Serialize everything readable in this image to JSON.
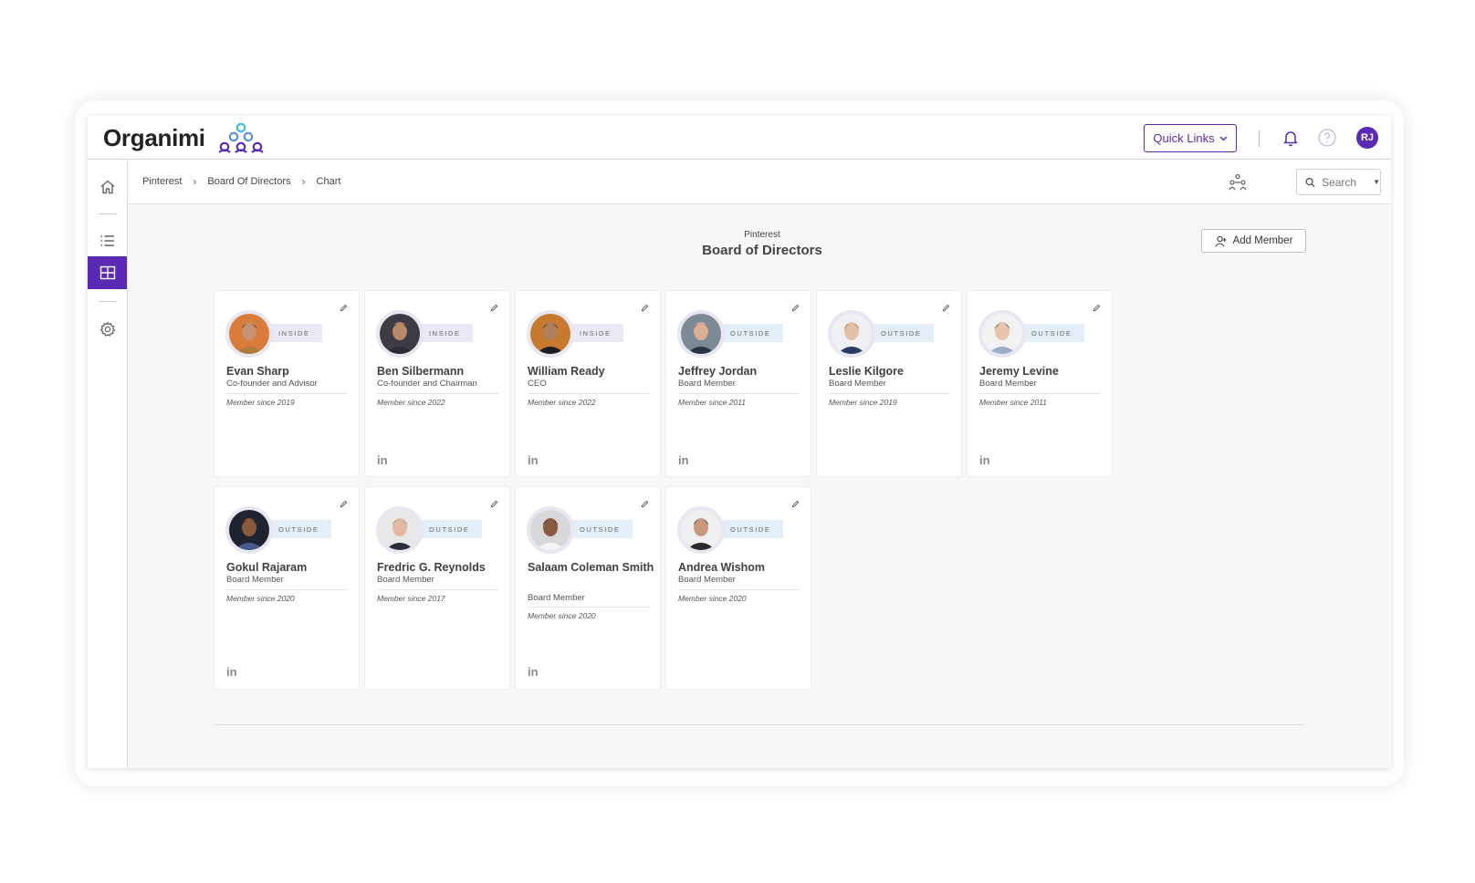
{
  "brand": {
    "name": "Organimi",
    "accent": "#5b2ab5"
  },
  "header": {
    "quick_links_label": "Quick Links",
    "user_initials": "RJ"
  },
  "sidebar": {
    "items": [
      "home-icon",
      "list-icon",
      "grid-icon",
      "settings-icon"
    ],
    "active": "grid-icon"
  },
  "breadcrumb": [
    "Pinterest",
    "Board Of Directors",
    "Chart"
  ],
  "search": {
    "placeholder": "Search"
  },
  "page": {
    "organization": "Pinterest",
    "title": "Board of Directors",
    "add_member_label": "Add Member"
  },
  "members": [
    {
      "name": "Evan Sharp",
      "role": "Co-founder and Advisor",
      "badge": "INSIDE",
      "since": "Member since 2019",
      "linkedin": false
    },
    {
      "name": "Ben Silbermann",
      "role": "Co-founder and Chairman",
      "badge": "INSIDE",
      "since": "Member since 2022",
      "linkedin": true
    },
    {
      "name": "William Ready",
      "role": "CEO",
      "badge": "INSIDE",
      "since": "Member since 2022",
      "linkedin": true
    },
    {
      "name": "Jeffrey Jordan",
      "role": "Board Member",
      "badge": "OUTSIDE",
      "since": "Member since 2011",
      "linkedin": true
    },
    {
      "name": "Leslie Kilgore",
      "role": "Board Member",
      "badge": "OUTSIDE",
      "since": "Member since 2019",
      "linkedin": false
    },
    {
      "name": "Jeremy Levine",
      "role": "Board Member",
      "badge": "OUTSIDE",
      "since": "Member since 2011",
      "linkedin": true
    },
    {
      "name": "Gokul Rajaram",
      "role": "Board Member",
      "badge": "OUTSIDE",
      "since": "Member since 2020",
      "linkedin": true
    },
    {
      "name": "Fredric G. Reynolds",
      "role": "Board Member",
      "badge": "OUTSIDE",
      "since": "Member since 2017",
      "linkedin": false
    },
    {
      "name": "Salaam Coleman Smith",
      "role": "Board Member",
      "badge": "OUTSIDE",
      "since": "Member since 2020",
      "linkedin": true
    },
    {
      "name": "Andrea Wishom",
      "role": "Board Member",
      "badge": "OUTSIDE",
      "since": "Member since 2020",
      "linkedin": false
    }
  ],
  "linkedin_label": "in"
}
